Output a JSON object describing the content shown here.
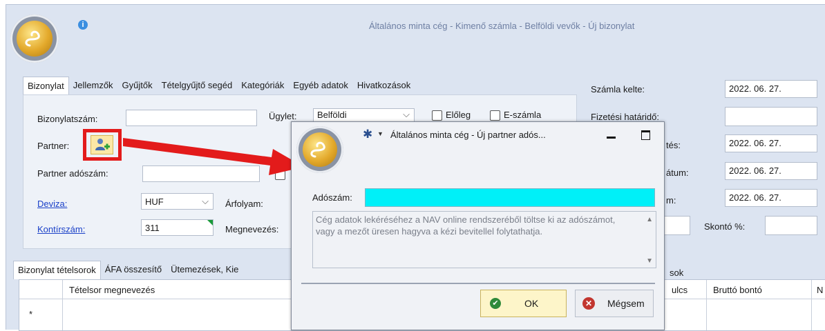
{
  "window": {
    "title": "Általános minta cég - Kimenő számla -  Belföldi vevők - Új bizonylat",
    "info_icon": "info-icon"
  },
  "top_tabs": [
    "Bizonylat",
    "Jellemzők",
    "Gyűjtők",
    "Tételgyűjtő segéd",
    "Kategóriák",
    "Egyéb adatok",
    "Hivatkozások"
  ],
  "form": {
    "bizonylatszam_label": "Bizonylatszám:",
    "bizonylatszam_value": "",
    "ugylet_label": "Ügylet:",
    "ugylet_value": "Belföldi",
    "eloleg_label": "Előleg",
    "eszamla_label": "E-számla",
    "partner_label": "Partner:",
    "partner_adoszam_label": "Partner adószám:",
    "partner_adoszam_value": "",
    "deviza_label": "Deviza:",
    "deviza_value": "HUF",
    "arfolyam_label": "Árfolyam:",
    "kontirszam_label": "Kontírszám:",
    "kontirszam_value": "311",
    "megnevezes_label": "Megnevezés:"
  },
  "right_panel": {
    "szamla_kelte_label": "Számla kelte:",
    "szamla_kelte_value": "2022. 06. 27.",
    "fizetesi_hatarido_label": "Fizetési határidő:",
    "fizetesi_hatarido_value": "",
    "row3_label_partial": "tés:",
    "row3_value": "2022. 06. 27.",
    "row4_label_partial": "átum:",
    "row4_value": "2022. 06. 27.",
    "row5_label_partial": "m:",
    "row5_value": "2022. 06. 27.",
    "skonto_label": "Skontó %:",
    "skonto_value": ""
  },
  "bottom_tabs": [
    "Bizonylat tételsorok",
    "ÁFA összesítő",
    "Ütemezések, Kie"
  ],
  "bottom_tab_right_partial": "sok",
  "grid": {
    "col_tetelsor": "Tételsor megnevezés",
    "col_ulcs_partial": "ulcs",
    "col_brutto": "Bruttó bontó",
    "col_n_partial": "N",
    "new_row_marker": "*"
  },
  "dialog": {
    "title": "Általános minta cég - Új partner adós...",
    "adoszam_label": "Adószám:",
    "adoszam_value": "",
    "hint": "Cég adatok lekéréséhez a NAV online rendszeréből töltse ki az adószámot, vagy a mezőt üresen hagyva a kézi bevitellel folytathatja.",
    "ok_label": "OK",
    "cancel_label": "Mégsem"
  },
  "colors": {
    "highlight_red": "#e31b1b",
    "adoszam_fill": "#00f0f8",
    "link_blue": "#1a40c8",
    "ok_fill": "#fdf5c9"
  }
}
